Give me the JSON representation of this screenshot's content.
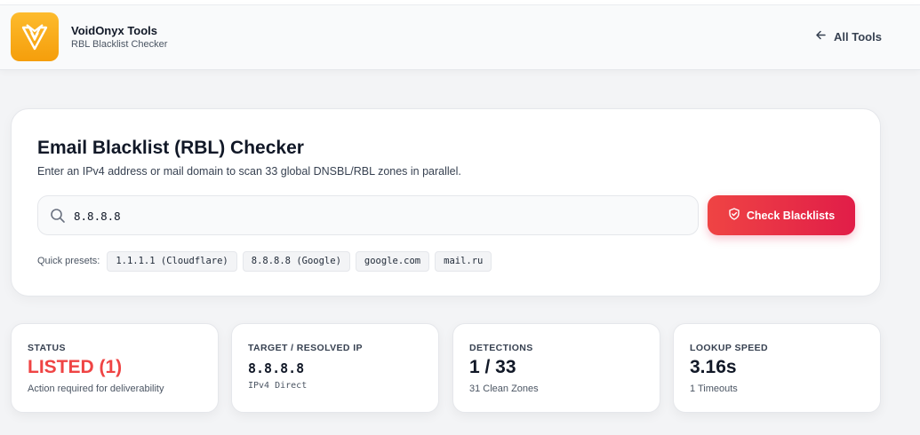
{
  "header": {
    "brand_title": "VoidOnyx Tools",
    "brand_subtitle": "RBL Blacklist Checker",
    "nav_all_tools": "All Tools"
  },
  "checker": {
    "title": "Email Blacklist (RBL) Checker",
    "description": "Enter an IPv4 address or mail domain to scan 33 global DNSBL/RBL zones in parallel.",
    "input_value": "8.8.8.8",
    "button_label": "Check Blacklists",
    "presets_label": "Quick presets:",
    "presets": [
      "1.1.1.1 (Cloudflare)",
      "8.8.8.8 (Google)",
      "google.com",
      "mail.ru"
    ]
  },
  "stats": [
    {
      "label": "STATUS",
      "value": "LISTED (1)",
      "note": "Action required for deliverability"
    },
    {
      "label": "TARGET / RESOLVED IP",
      "value": "8.8.8.8",
      "note": "IPv4 Direct"
    },
    {
      "label": "DETECTIONS",
      "value": "1 / 33",
      "note": "31 Clean Zones"
    },
    {
      "label": "LOOKUP SPEED",
      "value": "3.16s",
      "note": "1 Timeouts"
    }
  ],
  "colors": {
    "accent_red": "#ef4444",
    "button_gradient_end": "#e11d48",
    "logo_orange": "#f59e0b"
  },
  "icons": {
    "logo": "voidonyx-logo-icon",
    "back": "arrow-left-icon",
    "search": "search-icon",
    "button": "shield-check-icon"
  }
}
